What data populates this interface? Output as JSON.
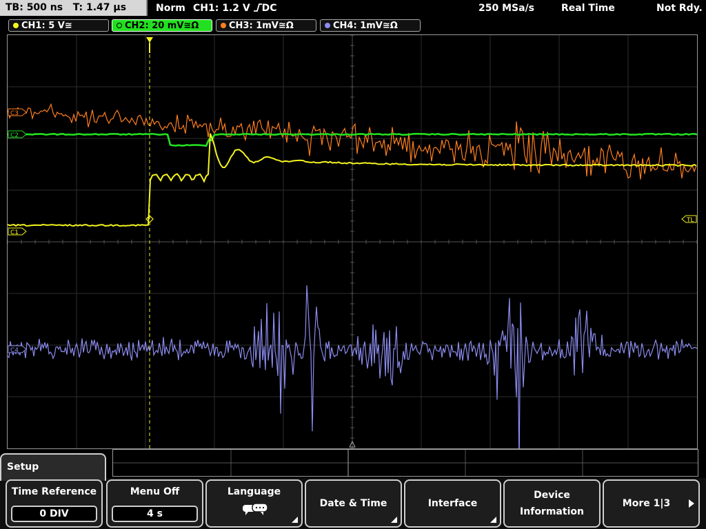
{
  "status": {
    "timebase": "TB: 500 ns",
    "trigger_time": "T: 1.47 µs",
    "trigger_mode": "Norm",
    "trigger_source": "CH1: 1.2 V",
    "trigger_coupling": "DC",
    "sample_rate": "250 MSa/s",
    "acquisition_mode": "Real Time",
    "ready_state": "Not Rdy."
  },
  "channels": [
    {
      "label": "CH1: 5 V≅",
      "color": "#f5f51e"
    },
    {
      "label": "CH2: 20 mV≅Ω",
      "color": "#22e020"
    },
    {
      "label": "CH3: 1mV≅Ω",
      "color": "#ff7f1e"
    },
    {
      "label": "CH4: 1mV≅Ω",
      "color": "#8c8cf0"
    }
  ],
  "markers": {
    "c3": "C3",
    "c2": "C2",
    "c1": "C1",
    "c4": "C4",
    "trigger_level": "TL"
  },
  "menu": {
    "title": "Setup",
    "time_reference": {
      "label": "Time Reference",
      "value": "0 DIV"
    },
    "menu_off": {
      "label": "Menu Off",
      "value": "4 s"
    },
    "language": {
      "label": "Language"
    },
    "date_time": {
      "label": "Date & Time"
    },
    "interface": {
      "label": "Interface"
    },
    "device_information": {
      "label_line1": "Device",
      "label_line2": "Information"
    },
    "more": {
      "label": "More 1|3"
    }
  }
}
